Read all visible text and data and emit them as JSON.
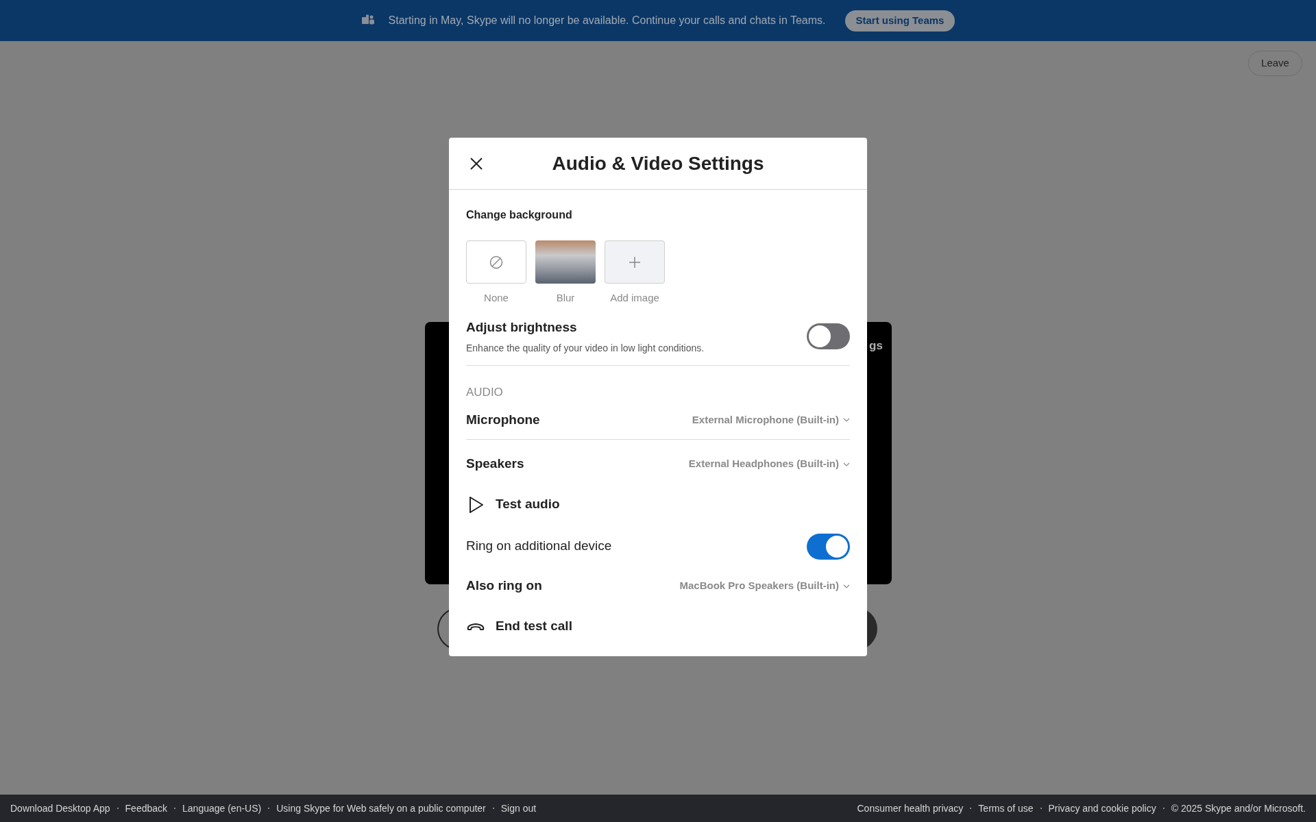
{
  "banner": {
    "message": "Starting in May, Skype will no longer be available. Continue your calls and chats in Teams.",
    "button": "Start using Teams"
  },
  "leave_button": "Leave",
  "call_panel": {
    "label_fragment": "gs"
  },
  "dialog": {
    "title": "Audio & Video Settings",
    "background_heading": "Change background",
    "backgrounds": [
      {
        "kind": "none",
        "label": "None"
      },
      {
        "kind": "blur",
        "label": "Blur"
      },
      {
        "kind": "add",
        "label": "Add image"
      }
    ],
    "brightness": {
      "label": "Adjust brightness",
      "description": "Enhance the quality of your video in low light conditions.",
      "on": false
    },
    "audio_heading": "AUDIO",
    "rows": [
      {
        "kind": "select",
        "label": "Microphone",
        "value": "External Microphone (Built-in)",
        "divider": true
      },
      {
        "kind": "select",
        "label": "Speakers",
        "value": "External Headphones (Built-in)",
        "divider": false
      },
      {
        "kind": "test",
        "label": "Test audio"
      },
      {
        "kind": "toggle",
        "label": "Ring on additional device",
        "on": true
      },
      {
        "kind": "select",
        "label": "Also ring on",
        "value": "MacBook Pro Speakers (Built-in)",
        "divider": false
      },
      {
        "kind": "hangup",
        "label": "End test call"
      }
    ]
  },
  "footer": {
    "left": [
      "Download Desktop App",
      "Feedback",
      "Language (en-US)",
      "Using Skype for Web safely on a public computer",
      "Sign out"
    ],
    "right": [
      "Consumer health privacy",
      "Terms of use",
      "Privacy and cookie policy",
      "© 2025 Skype and/or Microsoft."
    ]
  }
}
